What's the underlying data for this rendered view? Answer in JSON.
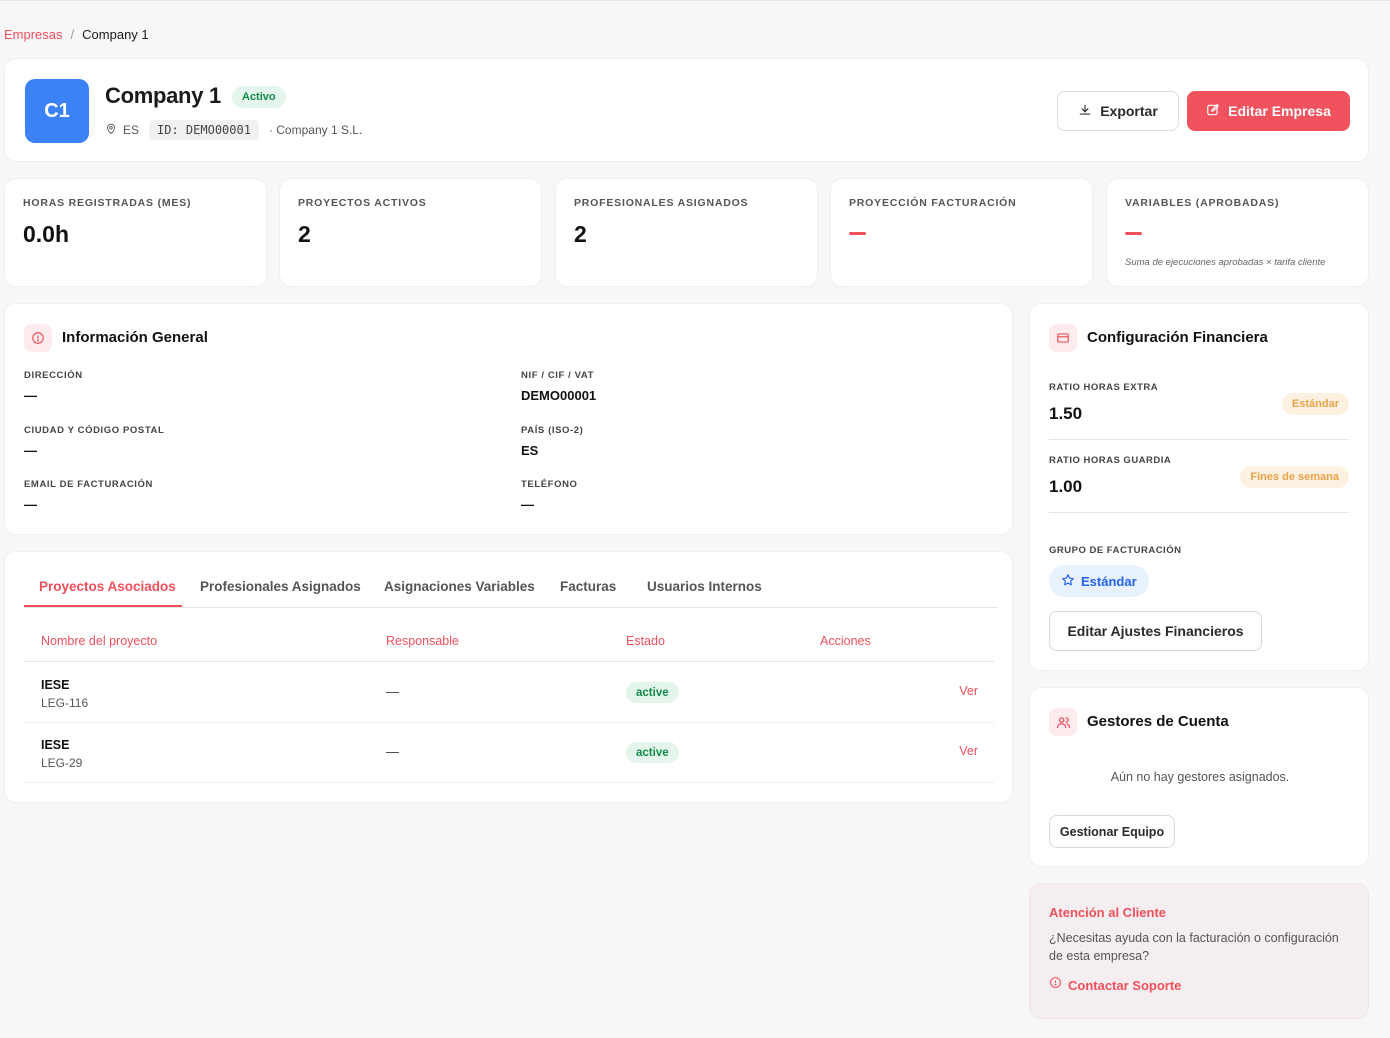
{
  "breadcrumb": {
    "parent": "Empresas",
    "separator": "/",
    "current": "Company 1"
  },
  "company": {
    "initials": "C1",
    "name": "Company 1",
    "status": "Activo",
    "country": "ES",
    "id_label": "ID: DEMO00001",
    "legal_name": "· Company 1 S.L."
  },
  "actions": {
    "export": "Exportar",
    "edit": "Editar Empresa"
  },
  "stats": [
    {
      "label": "HORAS REGISTRADAS (MES)",
      "value": "0.0h"
    },
    {
      "label": "PROYECTOS ACTIVOS",
      "value": "2"
    },
    {
      "label": "PROFESIONALES ASIGNADOS",
      "value": "2"
    },
    {
      "label": "PROYECCIÓN FACTURACIÓN",
      "value": ""
    },
    {
      "label": "VARIABLES (APROBADAS)",
      "value": "",
      "note": "Suma de ejecuciones aprobadas × tarifa cliente"
    }
  ],
  "info": {
    "title": "Información General",
    "fields": {
      "direccion": {
        "label": "DIRECCIÓN",
        "value": "—"
      },
      "ciudad": {
        "label": "CIUDAD Y CÓDIGO POSTAL",
        "value": "—"
      },
      "email": {
        "label": "EMAIL DE FACTURACIÓN",
        "value": "—"
      },
      "nif": {
        "label": "NIF / CIF / VAT",
        "value": "DEMO00001"
      },
      "pais": {
        "label": "PAÍS (ISO-2)",
        "value": "ES"
      },
      "telefono": {
        "label": "TELÉFONO",
        "value": "—"
      }
    }
  },
  "tabs": [
    "Proyectos Asociados",
    "Profesionales Asignados",
    "Asignaciones Variables",
    "Facturas",
    "Usuarios Internos"
  ],
  "table": {
    "headers": [
      "Nombre del proyecto",
      "Responsable",
      "Estado",
      "Acciones"
    ],
    "rows": [
      {
        "name": "IESE",
        "code": "LEG-116",
        "responsable": "—",
        "estado": "active",
        "action": "Ver"
      },
      {
        "name": "IESE",
        "code": "LEG-29",
        "responsable": "—",
        "estado": "active",
        "action": "Ver"
      }
    ]
  },
  "finance": {
    "title": "Configuración Financiera",
    "ratio_extra": {
      "label": "RATIO HORAS EXTRA",
      "value": "1.50",
      "badge": "Estándar"
    },
    "ratio_guardia": {
      "label": "RATIO HORAS GUARDIA",
      "value": "1.00",
      "badge": "Fines de semana"
    },
    "grupo": {
      "label": "GRUPO DE FACTURACIÓN",
      "value": "Estándar"
    },
    "button": "Editar Ajustes Financieros"
  },
  "gestores": {
    "title": "Gestores de Cuenta",
    "empty": "Aún no hay gestores asignados.",
    "button": "Gestionar Equipo"
  },
  "support": {
    "title": "Atención al Cliente",
    "text": "¿Necesitas ayuda con la facturación o configuración de esta empresa?",
    "link": "Contactar Soporte"
  },
  "colors": {
    "accent": "#f0525e",
    "avatar": "#3b82f6",
    "success": "#138a4b",
    "warning": "#e8a24a",
    "info": "#2563eb"
  }
}
